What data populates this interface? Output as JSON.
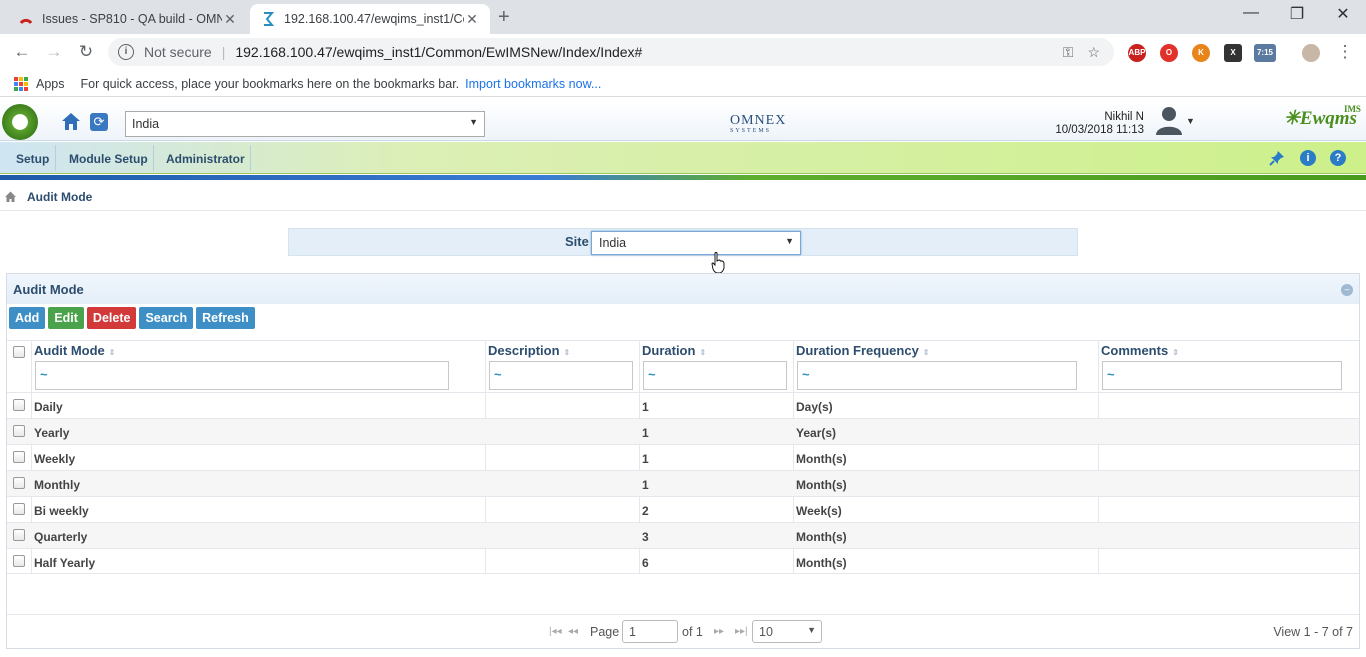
{
  "browser": {
    "tabs": [
      {
        "title": "Issues - SP810 - QA build - OMN",
        "close": "✕"
      },
      {
        "title": "192.168.100.47/ewqims_inst1/Co",
        "close": "✕"
      }
    ],
    "new_tab": "+",
    "window_controls": {
      "minimize": "—",
      "maximize": "❐",
      "close": "✕"
    },
    "security_label": "Not secure",
    "url": "192.168.100.47/ewqims_inst1/Common/EwIMSNew/Index/Index#",
    "extensions": [
      {
        "name": "ABP",
        "color": "#c9211e"
      },
      {
        "name": "O",
        "color": "#e0312a"
      },
      {
        "name": "K",
        "color": "#e8841a"
      },
      {
        "name": "X",
        "color": "#333333"
      },
      {
        "name": "7:15",
        "color": "#5a7aa0"
      }
    ],
    "bookmarks": {
      "apps_label": "Apps",
      "hint": "For quick access, place your bookmarks here on the bookmarks bar.",
      "import_link": "Import bookmarks now..."
    }
  },
  "header": {
    "site_select": "India",
    "brand": "OMNEX",
    "brand_sub": "SYSTEMS",
    "user_name": "Nikhil N",
    "user_datetime": "10/03/2018 11:13",
    "product_logo": "Ewqms",
    "product_sup": "IMS"
  },
  "menu": {
    "items": [
      "Setup",
      "Module Setup",
      "Administrator"
    ]
  },
  "breadcrumb": {
    "label": "Audit Mode"
  },
  "site_filter": {
    "label": "Site",
    "value": "India"
  },
  "panel": {
    "title": "Audit Mode",
    "buttons": {
      "add": "Add",
      "edit": "Edit",
      "delete": "Delete",
      "search": "Search",
      "refresh": "Refresh"
    },
    "columns": [
      "Audit Mode",
      "Description",
      "Duration",
      "Duration Frequency",
      "Comments"
    ],
    "filter_placeholder": "~",
    "rows": [
      {
        "mode": "Daily",
        "description": "",
        "duration": "1",
        "frequency": "Day(s)",
        "comments": ""
      },
      {
        "mode": "Yearly",
        "description": "",
        "duration": "1",
        "frequency": "Year(s)",
        "comments": ""
      },
      {
        "mode": "Weekly",
        "description": "",
        "duration": "1",
        "frequency": "Month(s)",
        "comments": ""
      },
      {
        "mode": "Monthly",
        "description": "",
        "duration": "1",
        "frequency": "Month(s)",
        "comments": ""
      },
      {
        "mode": "Bi weekly",
        "description": "",
        "duration": "2",
        "frequency": "Week(s)",
        "comments": ""
      },
      {
        "mode": "Quarterly",
        "description": "",
        "duration": "3",
        "frequency": "Month(s)",
        "comments": ""
      },
      {
        "mode": "Half Yearly",
        "description": "",
        "duration": "6",
        "frequency": "Month(s)",
        "comments": ""
      }
    ],
    "pager": {
      "page_label": "Page",
      "page_value": "1",
      "of_label": "of 1",
      "rows_per_page": "10",
      "view_text": "View 1 - 7 of 7"
    }
  }
}
